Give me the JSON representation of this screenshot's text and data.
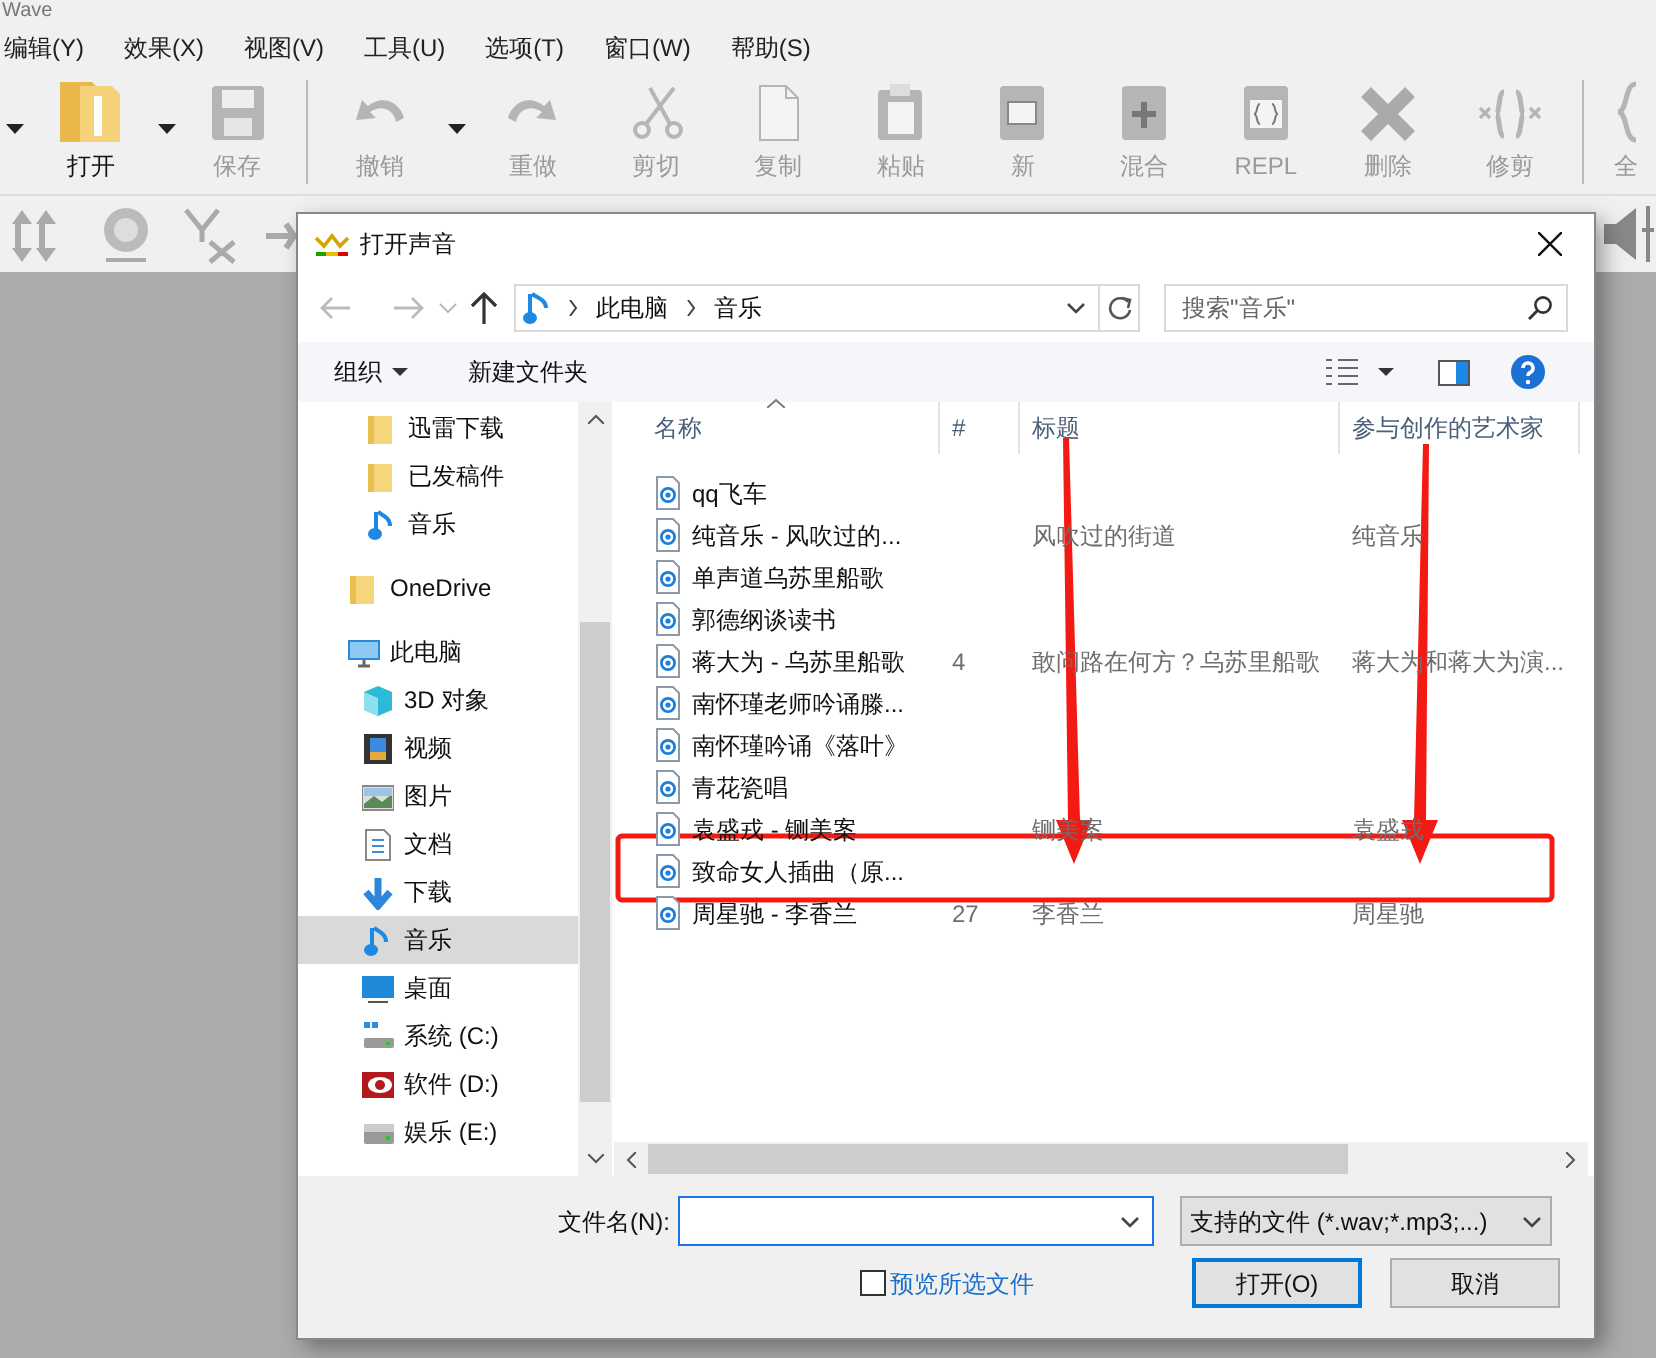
{
  "app": {
    "title": "Wave",
    "menu": [
      "编辑(Y)",
      "效果(X)",
      "视图(V)",
      "工具(U)",
      "选项(T)",
      "窗口(W)",
      "帮助(S)"
    ],
    "toolbar": [
      {
        "kind": "dropdown"
      },
      {
        "kind": "button",
        "label": "打开",
        "disabled": false
      },
      {
        "kind": "dropdown"
      },
      {
        "kind": "button",
        "label": "保存",
        "disabled": true
      },
      {
        "kind": "separator"
      },
      {
        "kind": "button",
        "label": "撤销",
        "disabled": true
      },
      {
        "kind": "dropdown"
      },
      {
        "kind": "button",
        "label": "重做",
        "disabled": true
      },
      {
        "kind": "button",
        "label": "剪切",
        "disabled": true
      },
      {
        "kind": "button",
        "label": "复制",
        "disabled": true
      },
      {
        "kind": "button",
        "label": "粘贴",
        "disabled": true
      },
      {
        "kind": "button",
        "label": "新",
        "disabled": true
      },
      {
        "kind": "button",
        "label": "混合",
        "disabled": true
      },
      {
        "kind": "button",
        "label": "REPL",
        "disabled": true
      },
      {
        "kind": "button",
        "label": "删除",
        "disabled": true
      },
      {
        "kind": "button",
        "label": "修剪",
        "disabled": true
      },
      {
        "kind": "separator"
      },
      {
        "kind": "button",
        "label": "全",
        "disabled": true
      }
    ]
  },
  "dialog": {
    "title": "打开声音",
    "address": [
      "此电脑",
      "音乐"
    ],
    "search": {
      "placeholder": "搜索\"音乐\""
    },
    "commands": [
      {
        "label": "组织",
        "dropdown": true
      },
      {
        "label": "新建文件夹",
        "dropdown": false
      }
    ],
    "sidebar": [
      {
        "label": "迅雷下载",
        "kind": "folder",
        "pinned": true,
        "selected": false
      },
      {
        "label": "已发稿件",
        "kind": "folder",
        "pinned": true,
        "selected": false
      },
      {
        "label": "音乐",
        "kind": "music",
        "pinned": true,
        "selected": false
      },
      {
        "label": "OneDrive",
        "kind": "folder",
        "pinned": false,
        "selected": false
      },
      {
        "label": "此电脑",
        "kind": "pc",
        "pinned": false,
        "selected": false,
        "children": [
          {
            "label": "3D 对象",
            "kind": "cube",
            "selected": false
          },
          {
            "label": "视频",
            "kind": "video",
            "selected": false
          },
          {
            "label": "图片",
            "kind": "image",
            "selected": false
          },
          {
            "label": "文档",
            "kind": "doc",
            "selected": false
          },
          {
            "label": "下载",
            "kind": "download",
            "selected": false
          },
          {
            "label": "音乐",
            "kind": "music",
            "selected": true
          },
          {
            "label": "桌面",
            "kind": "desktop",
            "selected": false
          },
          {
            "label": "系统 (C:)",
            "kind": "sysdrive",
            "selected": false
          },
          {
            "label": "软件 (D:)",
            "kind": "reddrive",
            "selected": false
          },
          {
            "label": "娱乐 (E:)",
            "kind": "drive",
            "selected": false
          }
        ]
      }
    ],
    "columns": [
      {
        "label": "名称",
        "sorted": true
      },
      {
        "label": "#",
        "sorted": false
      },
      {
        "label": "标题",
        "sorted": false
      },
      {
        "label": "参与创作的艺术家",
        "sorted": false
      }
    ],
    "rows": [
      {
        "name": "qq飞车"
      },
      {
        "name": "纯音乐 - 风吹过的...",
        "title": "风吹过的街道",
        "artist": "纯音乐"
      },
      {
        "name": "单声道乌苏里船歌"
      },
      {
        "name": "郭德纲谈读书"
      },
      {
        "name": "蒋大为 - 乌苏里船歌",
        "number": "4",
        "title": "敢问路在何方？乌苏里船歌",
        "artist": "蒋大为和蒋大为演..."
      },
      {
        "name": "南怀瑾老师吟诵滕..."
      },
      {
        "name": "南怀瑾吟诵《落叶》"
      },
      {
        "name": "青花瓷唱"
      },
      {
        "name": "袁盛戎 - 铡美案",
        "title": "铡美案",
        "artist": "袁盛戎"
      },
      {
        "name": "致命女人插曲（原..."
      },
      {
        "name": "周星驰 - 李香兰",
        "number": "27",
        "title": "李香兰",
        "artist": "周星驰"
      }
    ],
    "filename_label": "文件名(N):",
    "filetype": "支持的文件 (*.wav;*.mp3;...)",
    "preview": {
      "label": "预览所选文件",
      "checked": false
    },
    "buttons": [
      {
        "label": "打开(O)",
        "default": true
      },
      {
        "label": "取消",
        "default": false
      }
    ]
  },
  "annotations": [
    {
      "kind": "arrow"
    },
    {
      "kind": "arrow"
    },
    {
      "kind": "box"
    }
  ]
}
